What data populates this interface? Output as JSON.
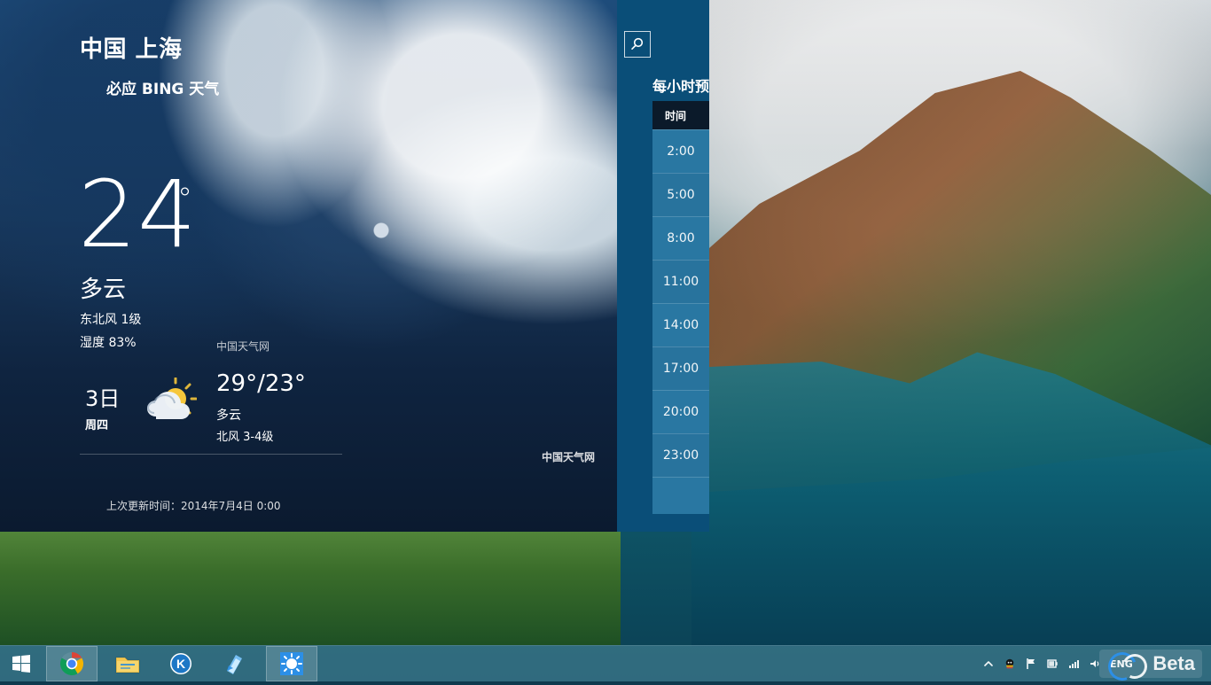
{
  "weather": {
    "location": "中国 上海",
    "provider": "必应 BING 天气",
    "current": {
      "temperature": "24",
      "degree_symbol": "°",
      "condition": "多云",
      "wind": "东北风 1级",
      "humidity": "湿度 83%",
      "source": "中国天气网"
    },
    "forecast": {
      "date": "3日",
      "weekday": "周四",
      "temp_range": "29°/23°",
      "condition": "多云",
      "wind": "北风 3-4级",
      "icon": "partly-cloudy-sun-icon"
    },
    "footer_source": "中国天气网",
    "last_updated": "上次更新时间：2014年7月4日 0:00"
  },
  "hourly": {
    "title": "每小时预",
    "header": "时间",
    "times": [
      "2:00",
      "5:00",
      "8:00",
      "11:00",
      "14:00",
      "17:00",
      "20:00",
      "23:00"
    ]
  },
  "taskbar": {
    "items": [
      {
        "name": "start-button",
        "icon": "windows-logo-icon"
      },
      {
        "name": "chrome",
        "icon": "chrome-icon"
      },
      {
        "name": "file-explorer",
        "icon": "folder-icon"
      },
      {
        "name": "k-app",
        "icon": "k-circle-icon"
      },
      {
        "name": "notepad",
        "icon": "pad-icon"
      },
      {
        "name": "weather-app",
        "icon": "weather-app-icon"
      }
    ],
    "tray": {
      "text": "ENG",
      "badge_text": "Beta"
    }
  },
  "colors": {
    "hourly_panel": "#0a4e78",
    "hourly_row": "#2b7aa5",
    "taskbar": "#3e7a8c"
  }
}
